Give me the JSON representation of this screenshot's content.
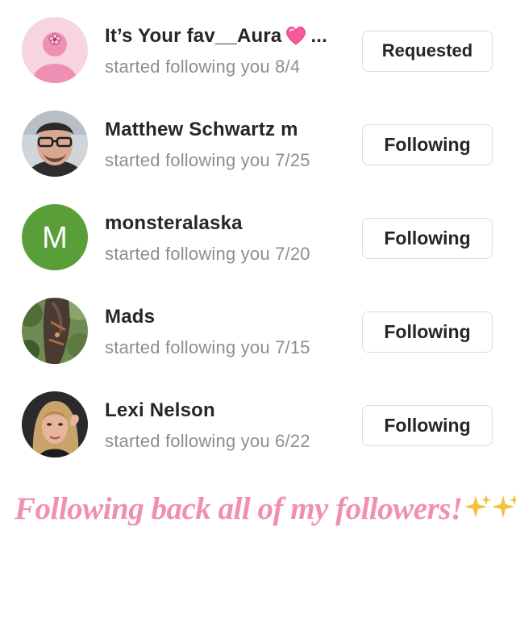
{
  "followers": [
    {
      "name": "It’s Your fav__Aura",
      "trailing": "...",
      "activity": "started following you 8/4",
      "button": "Requested",
      "avatar": "default-pink-avatar-icon"
    },
    {
      "name": "Matthew Schwartz m",
      "activity": "started following you 7/25",
      "button": "Following",
      "avatar": "man-with-glasses-photo"
    },
    {
      "name": "monsteralaska",
      "activity": "started following you 7/20",
      "button": "Following",
      "avatar_letter": "M",
      "avatar_color": "#5a9e3a"
    },
    {
      "name": "Mads",
      "activity": "started following you 7/15",
      "button": "Following",
      "avatar": "horse-photo"
    },
    {
      "name": "Lexi Nelson",
      "activity": "started following you 6/22",
      "button": "Following",
      "avatar": "woman-selfie-photo"
    }
  ],
  "caption": "Following back all of my followers!",
  "colors": {
    "caption": "#f08fb3",
    "subtext": "#8e8e8e",
    "text": "#262626",
    "button_border": "#dbdbdb"
  }
}
